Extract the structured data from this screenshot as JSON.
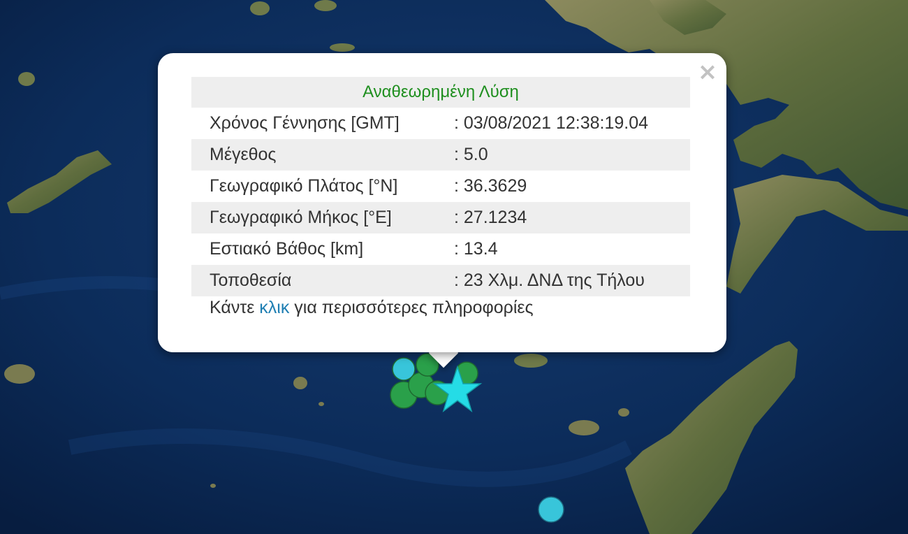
{
  "popup": {
    "title": "Αναθεωρημένη Λύση",
    "close_symbol": "×",
    "rows": [
      {
        "label": "Χρόνος Γέννησης [GMT]",
        "value": ": 03/08/2021 12:38:19.04"
      },
      {
        "label": "Μέγεθος",
        "value": ": 5.0"
      },
      {
        "label": "Γεωγραφικό Πλάτος [°N]",
        "value": ": 36.3629"
      },
      {
        "label": "Γεωγραφικό Μήκος [°E]",
        "value": ": 27.1234"
      },
      {
        "label": "Εστιακό Βάθος [km]",
        "value": ": 13.4"
      },
      {
        "label": "Τοποθεσία",
        "value": ": 23 Χλμ. ΔΝΔ της Τήλου"
      }
    ],
    "more_info_prefix": "Κάντε ",
    "more_info_link": "κλικ",
    "more_info_suffix": " για περισσότερες πληροφορίες"
  },
  "markers": {
    "main_event": "star-icon",
    "colors": {
      "main": "#25dce6",
      "recent": "#38c5da",
      "older": "#2aa04a"
    }
  },
  "colors": {
    "sea": "#0b2a55",
    "land": "#6b7a45",
    "title_green": "#1f8f1f",
    "link_blue": "#1f7fb3"
  }
}
